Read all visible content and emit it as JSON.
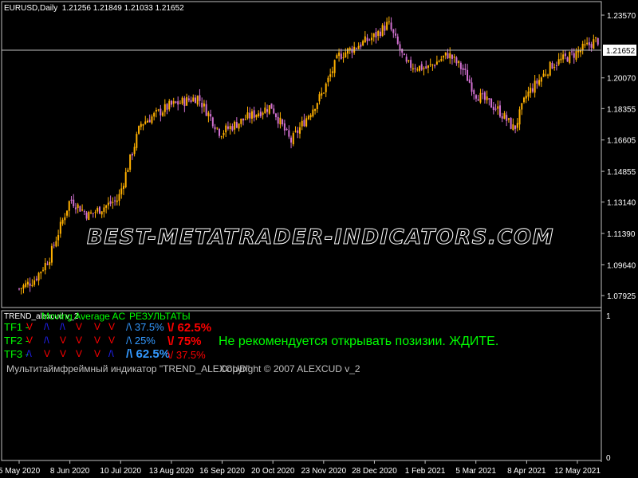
{
  "symbol_header": {
    "symbol": "EURUSD,Daily",
    "ohlc": "1.21256 1.21849 1.21033 1.21652"
  },
  "colors": {
    "background": "#000000",
    "bull_candle": "#ffb000",
    "bear_candle": "#d070d0",
    "grid_text": "#ffffff",
    "current_price_line": "#c0c0c0",
    "green_text": "#00ff00",
    "red_text": "#ff0000",
    "blue_text": "#3399ff"
  },
  "watermark": "BEST-METATRADER-INDICATORS.COM",
  "current_price": "1.21652",
  "chart_data": {
    "type": "candlestick",
    "symbol": "EURUSD",
    "timeframe": "Daily",
    "y_ticks": [
      "1.23570",
      "1.21652",
      "1.20070",
      "1.18355",
      "1.16605",
      "1.14855",
      "1.13140",
      "1.11390",
      "1.09640",
      "1.07925"
    ],
    "x_ticks": [
      "5 May 2020",
      "8 Jun 2020",
      "10 Jul 2020",
      "13 Aug 2020",
      "16 Sep 2020",
      "20 Oct 2020",
      "23 Nov 2020",
      "28 Dec 2020",
      "1 Feb 2021",
      "5 Mar 2021",
      "8 Apr 2021",
      "12 May 2021"
    ],
    "ylim": [
      1.0765,
      1.2385
    ],
    "close_path": [
      [
        "5 May 2020",
        1.083
      ],
      [
        "15 May 2020",
        1.088
      ],
      [
        "25 May 2020",
        1.1
      ],
      [
        "8 Jun 2020",
        1.133
      ],
      [
        "20 Jun 2020",
        1.124
      ],
      [
        "10 Jul 2020",
        1.133
      ],
      [
        "25 Jul 2020",
        1.175
      ],
      [
        "13 Aug 2020",
        1.185
      ],
      [
        "1 Sep 2020",
        1.19
      ],
      [
        "16 Sep 2020",
        1.17
      ],
      [
        "5 Oct 2020",
        1.179
      ],
      [
        "20 Oct 2020",
        1.185
      ],
      [
        "2 Nov 2020",
        1.165
      ],
      [
        "23 Nov 2020",
        1.192
      ],
      [
        "4 Dec 2020",
        1.213
      ],
      [
        "28 Dec 2020",
        1.224
      ],
      [
        "6 Jan 2021",
        1.231
      ],
      [
        "18 Jan 2021",
        1.208
      ],
      [
        "1 Feb 2021",
        1.206
      ],
      [
        "15 Feb 2021",
        1.214
      ],
      [
        "25 Feb 2021",
        1.205
      ],
      [
        "5 Mar 2021",
        1.192
      ],
      [
        "20 Mar 2021",
        1.183
      ],
      [
        "31 Mar 2021",
        1.172
      ],
      [
        "8 Apr 2021",
        1.191
      ],
      [
        "25 Apr 2021",
        1.208
      ],
      [
        "12 May 2021",
        1.215
      ],
      [
        "25 May 2021",
        1.222
      ],
      [
        "3 Jun 2021",
        1.2165
      ]
    ],
    "indicator_scale": [
      "1",
      "0"
    ]
  },
  "indicator": {
    "name": "TREND_alexcud v_2",
    "label_ma": "Moving Average AC",
    "label_results": "РЕЗУЛЬТАТЫ",
    "rows": [
      {
        "tf": "TF1 -",
        "symbols": [
          {
            "s": "V",
            "c": "red"
          },
          {
            "s": "/\\",
            "c": "navy"
          },
          {
            "s": "/\\",
            "c": "navy"
          },
          {
            "s": "V",
            "c": "red"
          },
          {
            "s": "V",
            "c": "red"
          },
          {
            "s": "V",
            "c": "red"
          }
        ],
        "up": "/\\ 37.5%",
        "down": "\\/ 62.5%"
      },
      {
        "tf": "TF2 -",
        "symbols": [
          {
            "s": "V",
            "c": "red"
          },
          {
            "s": "/\\",
            "c": "navy"
          },
          {
            "s": "V",
            "c": "red"
          },
          {
            "s": "V",
            "c": "red"
          },
          {
            "s": "V",
            "c": "red"
          },
          {
            "s": "V",
            "c": "red"
          }
        ],
        "up": "/\\ 25%",
        "down": "\\/ 75%"
      },
      {
        "tf": "TF3 -",
        "symbols": [
          {
            "s": "/\\",
            "c": "navy"
          },
          {
            "s": "V",
            "c": "red"
          },
          {
            "s": "V",
            "c": "red"
          },
          {
            "s": "V",
            "c": "red"
          },
          {
            "s": "V",
            "c": "red"
          },
          {
            "s": "/\\",
            "c": "navy"
          }
        ],
        "up": "/\\ 62.5%",
        "down": "\\/ 37.5%"
      }
    ],
    "message": "Не рекомендуется открывать позизии. ЖДИТЕ.",
    "footer_left": "Мультитаймфреймный индикатор \"TREND_ALEXCUD\"",
    "footer_right": "Copyright © 2007 ALEXCUD v_2"
  }
}
